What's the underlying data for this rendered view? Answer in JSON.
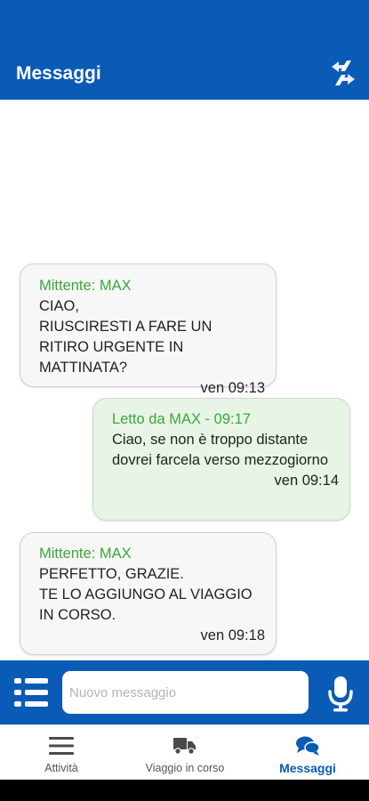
{
  "header": {
    "title": "Messaggi",
    "sync_icon": "sync-arrows-icon",
    "background": "#0a5bb5"
  },
  "messages": [
    {
      "direction": "incoming",
      "meta": "Mittente: MAX",
      "text": "CIAO,\nRIUSCIRESTI A FARE UN RITIRO URGENTE IN MATTINATA?",
      "time": "ven 09:13"
    },
    {
      "direction": "outgoing",
      "meta": "Letto da MAX - 09:17",
      "text": "Ciao, se non è troppo distante dovrei farcela verso mezzogiorno",
      "time": "ven 09:14"
    },
    {
      "direction": "incoming",
      "meta": "Mittente: MAX",
      "text": "PERFETTO, GRAZIE.\nTE LO AGGIUNGO AL VIAGGIO IN CORSO.",
      "time": "ven 09:18"
    }
  ],
  "composer": {
    "placeholder": "Nuovo messaggio",
    "value": "",
    "menu_icon": "list-icon",
    "mic_icon": "microphone-icon"
  },
  "bottom_nav": {
    "items": [
      {
        "label": "Attività",
        "icon": "hamburger-icon",
        "active": false
      },
      {
        "label": "Viaggio in corso",
        "icon": "truck-icon",
        "active": false
      },
      {
        "label": "Messaggi",
        "icon": "chat-bubbles-icon",
        "active": true
      }
    ]
  },
  "colors": {
    "primary": "#0a5bb5",
    "sender_green": "#3aa83a",
    "outgoing_bubble": "#e8f4e6",
    "incoming_bubble": "#f7f7f7"
  }
}
